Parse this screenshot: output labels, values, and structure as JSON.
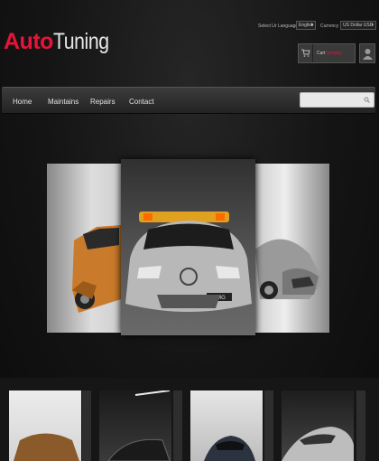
{
  "logo": {
    "part1": "Auto",
    "part2": "Tuning"
  },
  "header": {
    "language_label": "Select Ur Language :",
    "language_value": "English",
    "currency_label": "Currency :",
    "currency_value": "US Dollar USD",
    "cart_label": "Cart",
    "cart_status": "(empty)"
  },
  "nav": {
    "items": [
      {
        "label": "Home"
      },
      {
        "label": "Maintains"
      },
      {
        "label": "Repairs"
      },
      {
        "label": "Contact"
      }
    ],
    "search_placeholder": ""
  },
  "slider": {
    "center_plate": "AMG"
  },
  "colors": {
    "brand": "#e8133a",
    "nav_bg": "#2e2e2e",
    "page_bg": "#111111"
  },
  "icons": [
    "cart-icon",
    "user-icon",
    "search-icon",
    "dropdown-arrow-icon"
  ]
}
